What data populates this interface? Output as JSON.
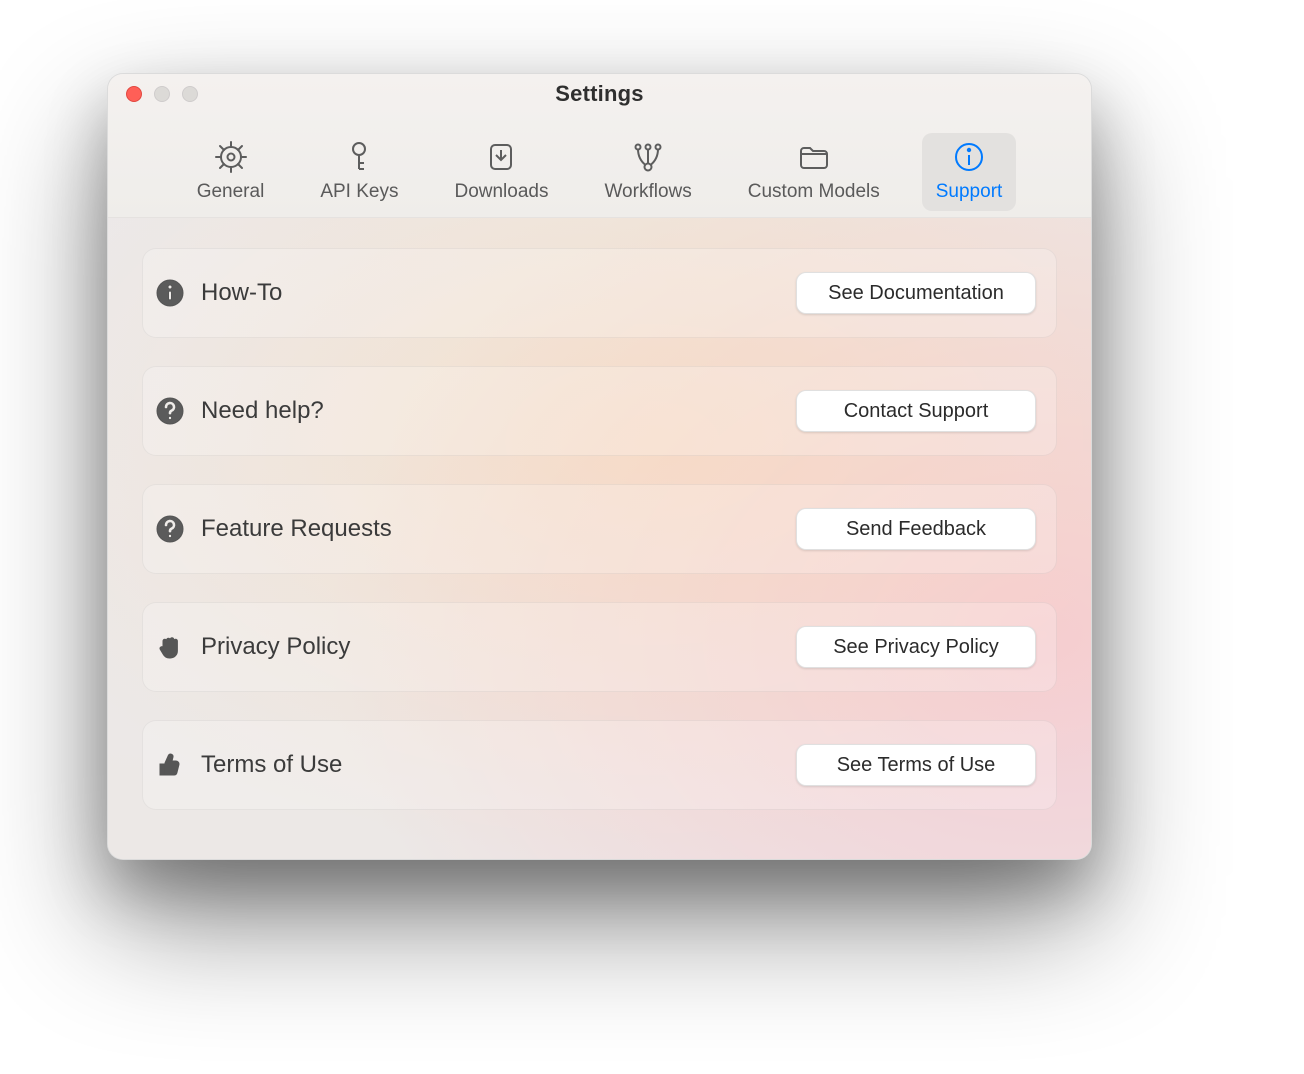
{
  "window": {
    "title": "Settings"
  },
  "tabs": [
    {
      "label": "General"
    },
    {
      "label": "API Keys"
    },
    {
      "label": "Downloads"
    },
    {
      "label": "Workflows"
    },
    {
      "label": "Custom Models"
    },
    {
      "label": "Support"
    }
  ],
  "activeTabIndex": 5,
  "rows": [
    {
      "label": "How-To",
      "button": "See Documentation"
    },
    {
      "label": "Need help?",
      "button": "Contact Support"
    },
    {
      "label": "Feature Requests",
      "button": "Send Feedback"
    },
    {
      "label": "Privacy Policy",
      "button": "See Privacy Policy"
    },
    {
      "label": "Terms of Use",
      "button": "See Terms of Use"
    }
  ],
  "colors": {
    "accent": "#007aff"
  }
}
